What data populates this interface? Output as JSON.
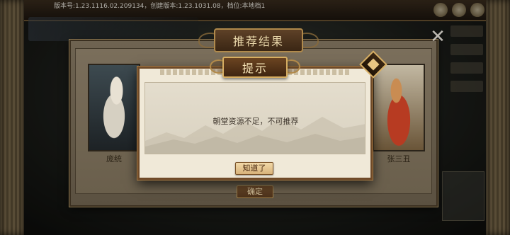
{
  "status_bar": {
    "version_text": "版本号:1.23.1116.02.209134，创建版本:1.23.1031.08，档位:本地档1"
  },
  "recommend_panel": {
    "title": "推荐结果",
    "left_card_name": "庞统",
    "right_card_name": "张三丑",
    "confirm_label": "确定",
    "close_icon": "close-icon"
  },
  "dialog": {
    "title": "提示",
    "message": "朝堂资源不足，不可推荐",
    "ok_label": "知道了",
    "corner_icon": "diamond-ornament-icon"
  },
  "colors": {
    "dialog_border": "#6f4a28",
    "title_plate": "#4f3217",
    "ok_button": "#e4c590"
  }
}
